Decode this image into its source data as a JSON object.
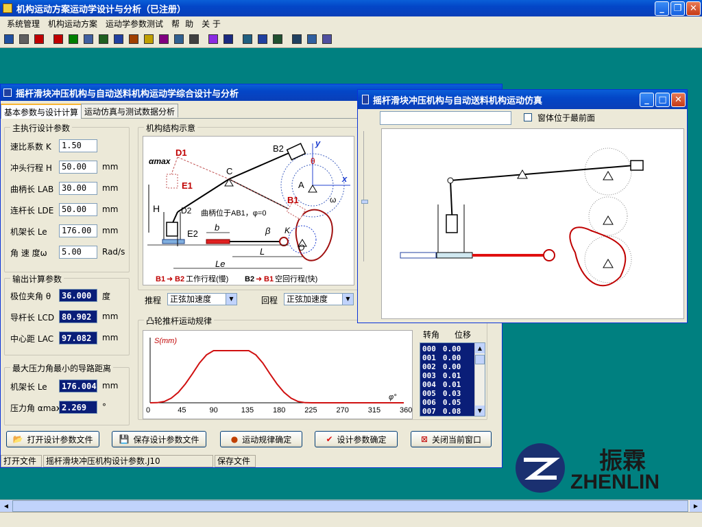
{
  "app": {
    "title": "机构运动方案运动学设计与分析（已注册）"
  },
  "menu": [
    "系统管理",
    "机构运动方案",
    "运动学参数测试",
    "帮",
    "助",
    "关 于"
  ],
  "design": {
    "title": "摇杆滑块冲压机构与自动送料机构运动学综合设计与分析",
    "tabs": [
      "基本参数与设计计算",
      "运动仿真与测试数据分析"
    ],
    "main_params": {
      "group": "主执行设计参数",
      "rows": [
        {
          "label": "速比系数 K",
          "value": "1.50",
          "unit": ""
        },
        {
          "label": "冲头行程 H",
          "value": "50.00",
          "unit": "mm"
        },
        {
          "label": "曲柄长 LAB",
          "value": "30.00",
          "unit": "mm"
        },
        {
          "label": "连杆长 LDE",
          "value": "50.00",
          "unit": "mm"
        },
        {
          "label": "机架长 Le",
          "value": "176.00",
          "unit": "mm"
        },
        {
          "label": "角 速 度ω",
          "value": "5.00",
          "unit": "Rad/s"
        }
      ]
    },
    "output": {
      "group": "输出计算参数",
      "rows": [
        {
          "label": "极位夹角 θ",
          "value": "36.000",
          "unit": "度"
        },
        {
          "label": "导杆长 LCD",
          "value": "80.902",
          "unit": "mm"
        },
        {
          "label": "中心距 LAC",
          "value": "97.082",
          "unit": "mm"
        }
      ]
    },
    "pressure": {
      "group": "最大压力角最小的导路距离",
      "rows": [
        {
          "label": "机架长 Le",
          "value": "176.004",
          "unit": "mm"
        },
        {
          "label": "压力角 αmax",
          "value": "2.269",
          "unit": "°"
        }
      ]
    },
    "diagram": {
      "group": "机构结构示意",
      "labels": {
        "d1": "D1",
        "amax": "αmax",
        "e1": "E1",
        "h": "H",
        "d2": "D2",
        "e2": "E2",
        "b": "b",
        "c": "C",
        "b2": "B2",
        "y": "y",
        "theta": "θ",
        "a": "A",
        "x": "x",
        "b1": "B1",
        "omega": "ω",
        "beta": "β",
        "k": "K",
        "o": "O",
        "l": "L",
        "le": "Le"
      },
      "note": "曲柄位于AB1，φ=0",
      "legend": {
        "a1": "B1",
        "a2": "B2",
        "t1": "工作行程(慢)",
        "b1": "B2",
        "b2": "B1",
        "t2": "空回行程(快)"
      }
    },
    "push": {
      "label": "推程",
      "value": "正弦加速度"
    },
    "ret": {
      "label": "回程",
      "value": "正弦加速度"
    },
    "cam": {
      "group": "凸轮推杆运动规律",
      "ylabel": "S(mm)",
      "xlabel": "φ°"
    },
    "table": {
      "headers": [
        "转角",
        "位移"
      ],
      "rows": [
        [
          "000",
          "0.00"
        ],
        [
          "001",
          "0.00"
        ],
        [
          "002",
          "0.00"
        ],
        [
          "003",
          "0.01"
        ],
        [
          "004",
          "0.01"
        ],
        [
          "005",
          "0.03"
        ],
        [
          "006",
          "0.05"
        ],
        [
          "007",
          "0.08"
        ]
      ]
    },
    "buttons": [
      "打开设计参数文件",
      "保存设计参数文件",
      "运动规律确定",
      "设计参数确定",
      "关闭当前窗口"
    ],
    "status": [
      "打开文件",
      "摇杆滑块冲压机构设计参数.J10",
      "保存文件"
    ]
  },
  "chart_data": {
    "type": "line",
    "xlabel": "φ°",
    "ylabel": "S(mm)",
    "x": [
      0,
      45,
      90,
      135,
      180,
      225,
      270,
      315,
      360
    ],
    "tick_labels": [
      "0",
      "45",
      "90",
      "135",
      "180",
      "225",
      "270",
      "315",
      "360"
    ],
    "series": [
      {
        "x": [
          0,
          10,
          20,
          30,
          40,
          50,
          60,
          70,
          80,
          90,
          100,
          110,
          120,
          130,
          140,
          150,
          160,
          170,
          180,
          190,
          200,
          210,
          220,
          230,
          260,
          300,
          360
        ],
        "values": [
          0,
          0.05,
          0.4,
          1.4,
          3.2,
          5.8,
          8.9,
          12.2,
          14.7,
          16,
          16,
          16,
          16,
          16,
          16,
          14.7,
          12.2,
          8.9,
          5.8,
          3.2,
          1.4,
          0.4,
          0.05,
          0,
          0,
          0,
          0
        ]
      }
    ],
    "xlim": [
      0,
      360
    ],
    "ylim": [
      0,
      20
    ],
    "color": "#d01010"
  },
  "sim": {
    "title": "摇杆滑块冲压机构与自动送料机构运动仿真",
    "checkbox": "窗体位于最前面"
  },
  "logo": {
    "cn": "振霖",
    "en": "ZHENLIN"
  }
}
